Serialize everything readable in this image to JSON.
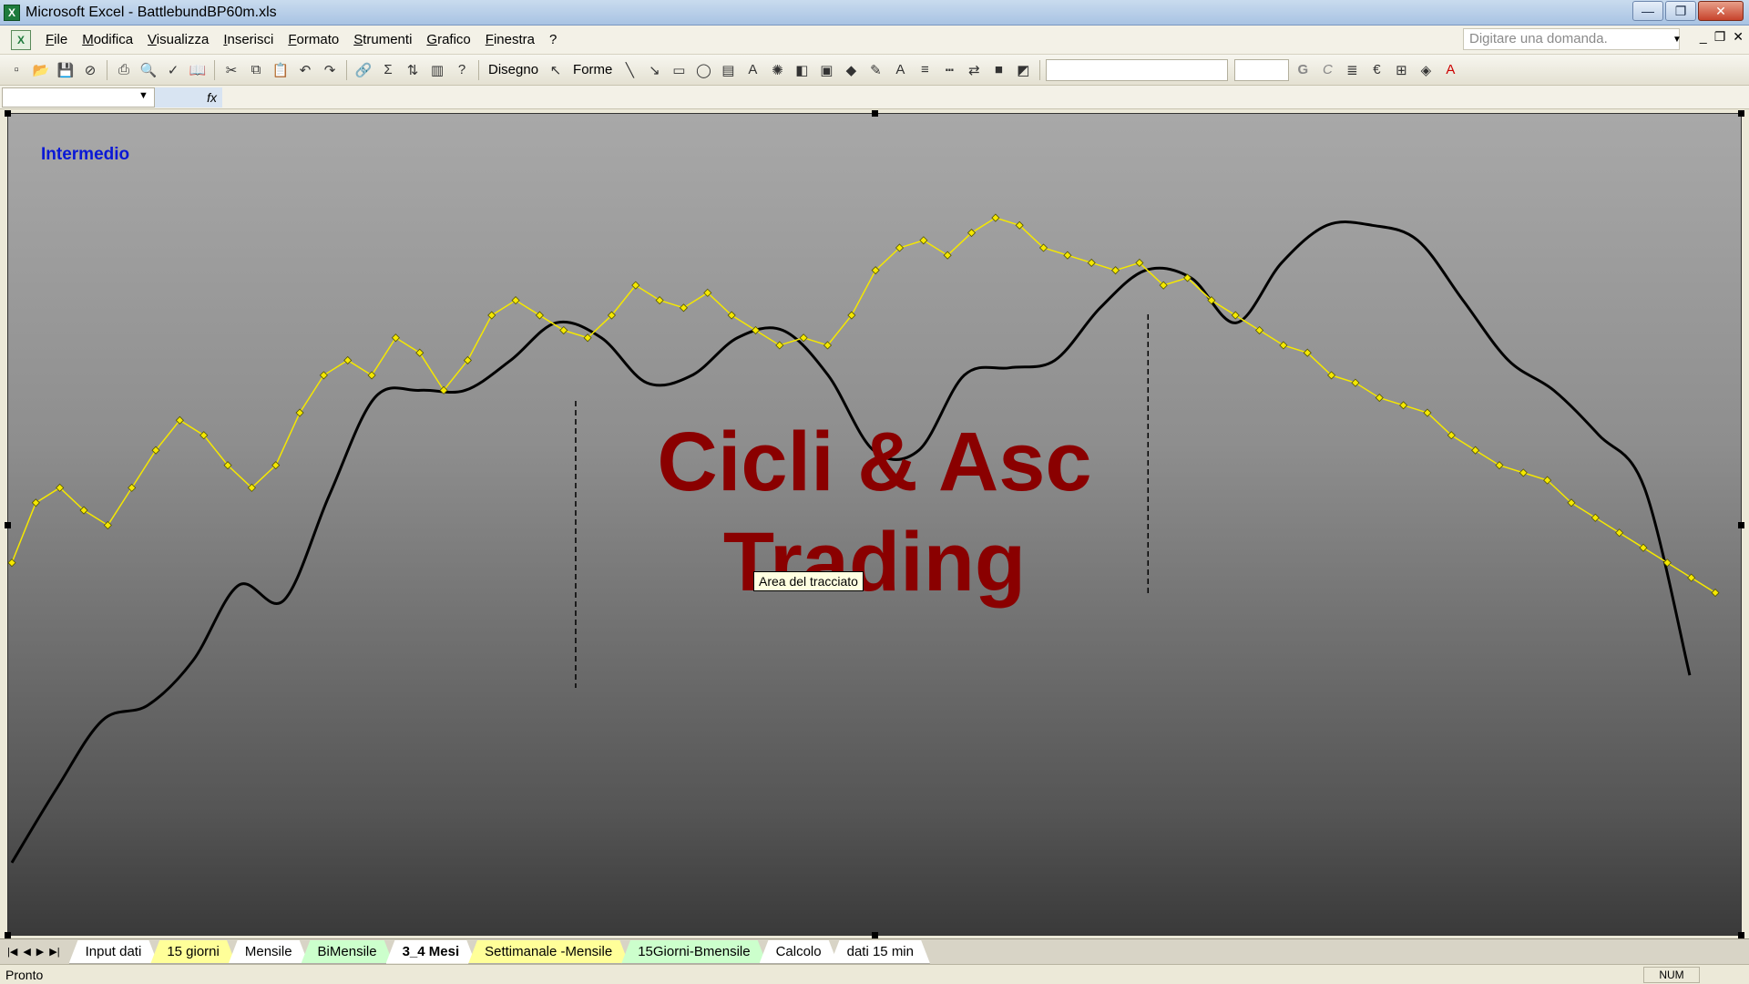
{
  "window": {
    "title": "Microsoft Excel - BattlebundBP60m.xls",
    "app_icon": "excel-icon",
    "minimize_label": "—",
    "maximize_label": "❐",
    "close_label": "✕"
  },
  "menu": {
    "items": [
      "File",
      "Modifica",
      "Visualizza",
      "Inserisci",
      "Formato",
      "Strumenti",
      "Grafico",
      "Finestra",
      "?"
    ],
    "help_placeholder": "Digitare una domanda.",
    "doc_min": "_",
    "doc_restore": "❐",
    "doc_close": "✕"
  },
  "toolbar": {
    "disegno_label": "Disegno",
    "forme_label": "Forme",
    "bold_label": "G",
    "italic_label": "C",
    "euro_label": "€"
  },
  "formula_bar": {
    "name_box": "",
    "fx_label": "fx"
  },
  "chart": {
    "label": "Intermedio",
    "watermark_line1": "Cicli & Asc",
    "watermark_line2": "Trading",
    "tooltip": "Area del tracciato",
    "colors": {
      "price_series": "#f5e800",
      "cycle_series": "#000000",
      "watermark": "#8a0000",
      "label": "#0a18d6"
    }
  },
  "chart_data": {
    "type": "line",
    "title": "",
    "xlabel": "",
    "ylabel": "",
    "ylim": [
      0,
      100
    ],
    "dashed_markers_x": [
      0.331,
      0.667
    ],
    "series": [
      {
        "values": [
          45,
          53,
          55,
          52,
          50,
          55,
          60,
          64,
          62,
          58,
          55,
          58,
          65,
          70,
          72,
          70,
          75,
          73,
          68,
          72,
          78,
          80,
          78,
          76,
          75,
          78,
          82,
          80,
          79,
          81,
          78,
          76,
          74,
          75,
          74,
          78,
          84,
          87,
          88,
          86,
          89,
          91,
          90,
          87,
          86,
          85,
          84,
          85,
          82,
          83,
          80,
          78,
          76,
          74,
          73,
          70,
          69,
          67,
          66,
          65,
          62,
          60,
          58,
          57,
          56,
          53,
          51,
          49,
          47,
          45,
          43,
          41
        ]
      },
      {
        "values": [
          5,
          15,
          24,
          26,
          32,
          42,
          40,
          54,
          67,
          68,
          68,
          72,
          77,
          75,
          69,
          70,
          75,
          76,
          70,
          60,
          60,
          70,
          71,
          72,
          79,
          84,
          83,
          77,
          85,
          90,
          90,
          88,
          80,
          72,
          68,
          62,
          55,
          30
        ]
      }
    ]
  },
  "sheet_tabs": [
    {
      "label": "Input dati",
      "style": "white"
    },
    {
      "label": "15 giorni",
      "style": "yellow"
    },
    {
      "label": "Mensile",
      "style": "white"
    },
    {
      "label": "BiMensile",
      "style": "green"
    },
    {
      "label": "3_4 Mesi",
      "style": "active"
    },
    {
      "label": "Settimanale -Mensile",
      "style": "yellow"
    },
    {
      "label": "15Giorni-Bmensile",
      "style": "green"
    },
    {
      "label": "Calcolo",
      "style": "white"
    },
    {
      "label": "dati 15 min",
      "style": "white"
    }
  ],
  "status": {
    "text": "Pronto",
    "num": "NUM"
  }
}
